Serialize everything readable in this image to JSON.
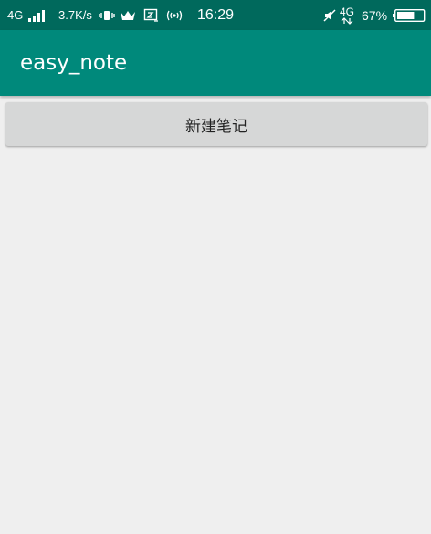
{
  "status_bar": {
    "network_type": "4G",
    "net_speed": "3.7K/s",
    "time": "16:29",
    "network_type_right": "4G",
    "battery_percent": "67%",
    "battery_level": 0.67,
    "icons": [
      "signal-bars-icon",
      "vibrate-icon",
      "crown-icon",
      "screenshot-icon",
      "hotspot-icon",
      "mute-icon",
      "data-arrows-icon",
      "battery-icon"
    ]
  },
  "app_bar": {
    "title": "easy_note",
    "color": "#00897b",
    "status_color": "#00695c"
  },
  "main": {
    "new_note_label": "新建笔记"
  }
}
